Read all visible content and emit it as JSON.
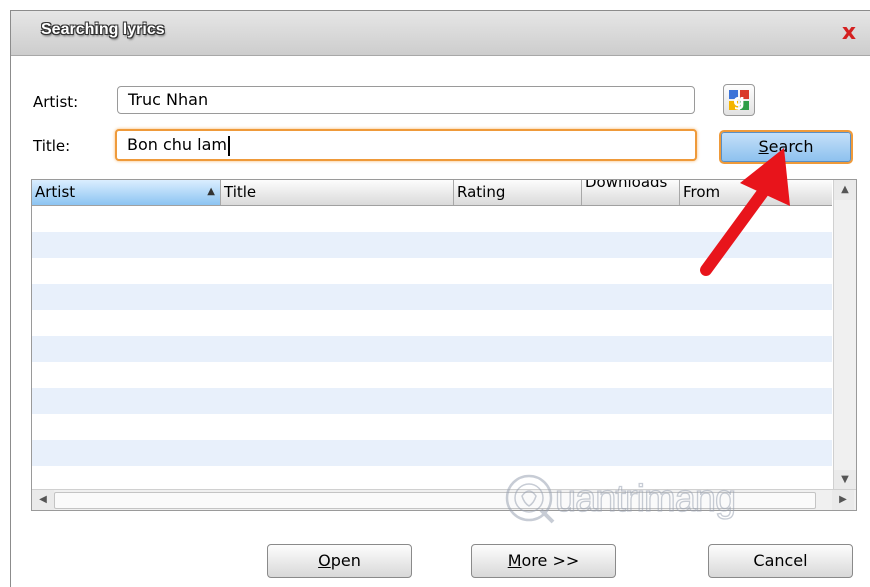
{
  "window": {
    "title": "Searching lyrics",
    "close_glyph": "x"
  },
  "form": {
    "artist_label": "Artist:",
    "artist_value": "Truc Nhan",
    "title_label": "Title:",
    "title_value": "Bon chu lam",
    "google_icon": "google-icon",
    "search_label_key": "S",
    "search_label_rest": "earch"
  },
  "results": {
    "columns": [
      {
        "label": "Artist",
        "sorted": "ascending"
      },
      {
        "label": "Title"
      },
      {
        "label": "Rating"
      },
      {
        "label": "Downloads"
      },
      {
        "label": "From"
      }
    ],
    "rows": []
  },
  "buttons": {
    "open_key": "O",
    "open_rest": "pen",
    "more_key": "M",
    "more_rest": "ore >>",
    "cancel_label": "Cancel"
  },
  "watermark": {
    "text": "uantrimang"
  },
  "colors": {
    "accent_focus": "#ef9a3a",
    "close_red": "#d42020",
    "annotation_arrow": "#e8141b",
    "row_alt": "#e8f0fb"
  }
}
